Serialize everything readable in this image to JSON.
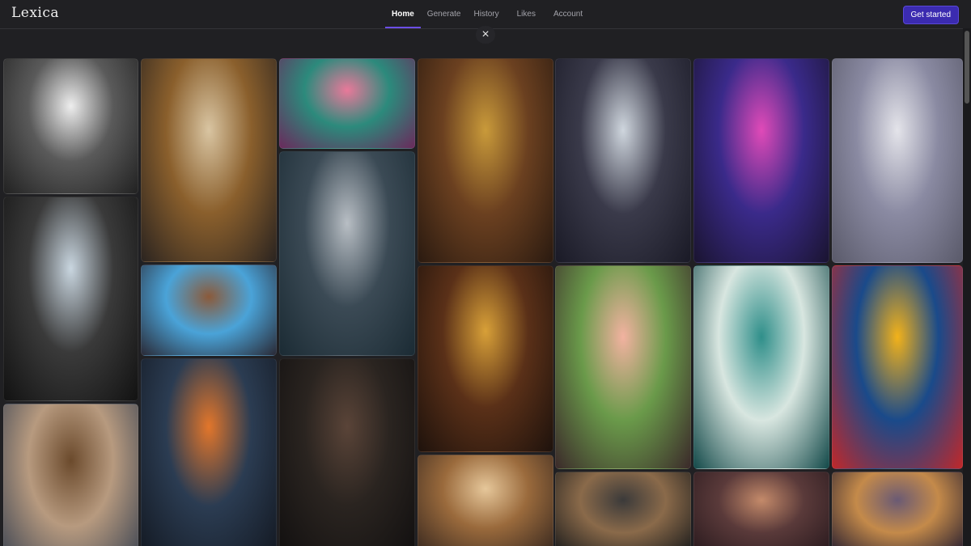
{
  "app": {
    "logo": "Lexica"
  },
  "nav": [
    {
      "label": "Home",
      "active": true
    },
    {
      "label": "Generate"
    },
    {
      "label": "History"
    },
    {
      "label": "Likes"
    },
    {
      "label": "Account"
    }
  ],
  "cta": {
    "label": "Get started"
  },
  "close": {
    "glyph": "×"
  },
  "gallery": [
    {
      "name": "gallery-image-dragon-castle",
      "colors": [
        "#eeeeee",
        "#5a5a5a",
        "#222222"
      ]
    },
    {
      "name": "gallery-image-glass-house",
      "colors": [
        "#c9d6e0",
        "#3a3a3a",
        "#121212"
      ]
    },
    {
      "name": "gallery-image-man-suit-portrait",
      "colors": [
        "#6b4a2c",
        "#b79a7f",
        "#3c4452"
      ]
    },
    {
      "name": "gallery-image-grocery-store",
      "colors": [
        "#d9c5a2",
        "#8a5f2c",
        "#2b2420"
      ]
    },
    {
      "name": "gallery-image-pokemon-toys",
      "colors": [
        "#8b5a3a",
        "#4aa3d8",
        "#2a2a36"
      ]
    },
    {
      "name": "gallery-image-fox-popcorn",
      "colors": [
        "#e2762b",
        "#2b3c52",
        "#141a24"
      ]
    },
    {
      "name": "gallery-image-flower-woman",
      "colors": [
        "#e9799a",
        "#2c8a7c",
        "#6a2a5c"
      ]
    },
    {
      "name": "gallery-image-spiderman-sphere",
      "colors": [
        "#b8bec4",
        "#3b4a55",
        "#1b2b34"
      ]
    },
    {
      "name": "gallery-image-man-portrait",
      "colors": [
        "#5a4438",
        "#2a2420",
        "#121010"
      ]
    },
    {
      "name": "gallery-image-golden-woman",
      "colors": [
        "#c99a3a",
        "#6b4020",
        "#2a1a10"
      ]
    },
    {
      "name": "gallery-image-golden-headdress",
      "colors": [
        "#d8a038",
        "#5a3018",
        "#1e120c"
      ]
    },
    {
      "name": "gallery-image-market-woman",
      "colors": [
        "#e6c79a",
        "#9a6a3c",
        "#3b2a20"
      ]
    },
    {
      "name": "gallery-image-robot",
      "colors": [
        "#cfd6de",
        "#3a3a4a",
        "#1a1a26"
      ]
    },
    {
      "name": "gallery-image-anime-grocery",
      "colors": [
        "#f2b2a0",
        "#6a9a4a",
        "#3b2a2a"
      ]
    },
    {
      "name": "gallery-image-workshop",
      "colors": [
        "#3b3a3a",
        "#8a6a4a",
        "#1c1c1c"
      ]
    },
    {
      "name": "gallery-image-cyberpunk-girl",
      "colors": [
        "#e04ab8",
        "#3a2a8a",
        "#1a1430"
      ]
    },
    {
      "name": "gallery-image-fairy-water",
      "colors": [
        "#2f8f8a",
        "#d8e6e0",
        "#144a4a"
      ]
    },
    {
      "name": "gallery-image-arches",
      "colors": [
        "#c48a6a",
        "#5a3a3a",
        "#2a1a1e"
      ]
    },
    {
      "name": "gallery-image-silver-hair-girl",
      "colors": [
        "#e4e4ea",
        "#8a8aa2",
        "#5a5a6a"
      ]
    },
    {
      "name": "gallery-image-abstract-eye",
      "colors": [
        "#f2b21a",
        "#1a4a8a",
        "#c0282a"
      ]
    },
    {
      "name": "gallery-image-cat-window",
      "colors": [
        "#6a5a74",
        "#c48a4a",
        "#2a2030"
      ]
    }
  ]
}
